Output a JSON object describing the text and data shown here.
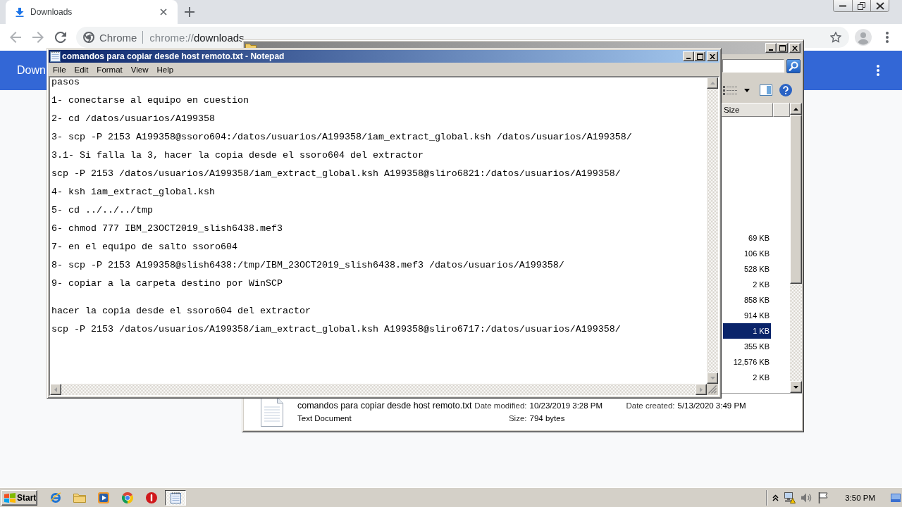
{
  "browser": {
    "tabs": [
      {
        "title": "Downloads",
        "selected": true
      }
    ],
    "omnibox": {
      "site_chip": "Chrome",
      "url_scheme": "chrome://",
      "url_path": "downloads"
    },
    "page": {
      "title": "Down"
    }
  },
  "explorer": {
    "columns": [
      {
        "label": "Size"
      }
    ],
    "rows": [
      {
        "size": "69 KB",
        "selected": false
      },
      {
        "size": "106 KB",
        "selected": false
      },
      {
        "size": "528 KB",
        "selected": false
      },
      {
        "size": "2 KB",
        "selected": false
      },
      {
        "size": "858 KB",
        "selected": false
      },
      {
        "size": "914 KB",
        "selected": false
      },
      {
        "size": "1 KB",
        "selected": true
      },
      {
        "size": "355 KB",
        "selected": false
      },
      {
        "size": "12,576 KB",
        "selected": false
      },
      {
        "size": "2 KB",
        "selected": false
      }
    ],
    "details": {
      "file_name": "comandos para copiar desde host remoto.txt",
      "file_type": "Text Document",
      "properties": [
        {
          "label": "Date modified:",
          "value": "10/23/2019 3:28 PM"
        },
        {
          "label": "Date created:",
          "value": "5/13/2020 3:49 PM"
        },
        {
          "label": "Size:",
          "value": "794 bytes"
        }
      ]
    }
  },
  "notepad": {
    "title": "comandos para copiar desde host remoto.txt - Notepad",
    "menu": [
      {
        "label": "File"
      },
      {
        "label": "Edit"
      },
      {
        "label": "Format"
      },
      {
        "label": "View"
      },
      {
        "label": "Help"
      }
    ],
    "text": "pasos\n\n1- conectarse al equipo en cuestion\n\n2- cd /datos/usuarios/A199358\n\n3- scp -P 2153 A199358@ssoro604:/datos/usuarios/A199358/iam_extract_global.ksh /datos/usuarios/A199358/\n\n3.1- Si falla la 3, hacer la copia desde el ssoro604 del extractor\n\nscp -P 2153 /datos/usuarios/A199358/iam_extract_global.ksh A199358@sliro6821:/datos/usuarios/A199358/\n\n4- ksh iam_extract_global.ksh\n\n5- cd ../../../tmp\n\n6- chmod 777 IBM_23OCT2019_slish6438.mef3\n\n7- en el equipo de salto ssoro604\n\n8- scp -P 2153 A199358@slish6438:/tmp/IBM_23OCT2019_slish6438.mef3 /datos/usuarios/A199358/\n\n9- copiar a la carpeta destino por WinSCP\n\n\nhacer la copia desde el ssoro604 del extractor\n\nscp -P 2153 /datos/usuarios/A199358/iam_extract_global.ksh A199358@sliro6717:/datos/usuarios/A199358/"
  },
  "taskbar": {
    "start_label": "Start",
    "buttons": [
      {
        "kind": "browser",
        "selected": false
      },
      {
        "kind": "folder",
        "selected": false
      },
      {
        "kind": "media",
        "selected": false
      },
      {
        "kind": "chrome",
        "selected": false
      },
      {
        "kind": "stop",
        "selected": false
      },
      {
        "kind": "notepad",
        "selected": true
      }
    ],
    "clock": "3:50 PM"
  }
}
